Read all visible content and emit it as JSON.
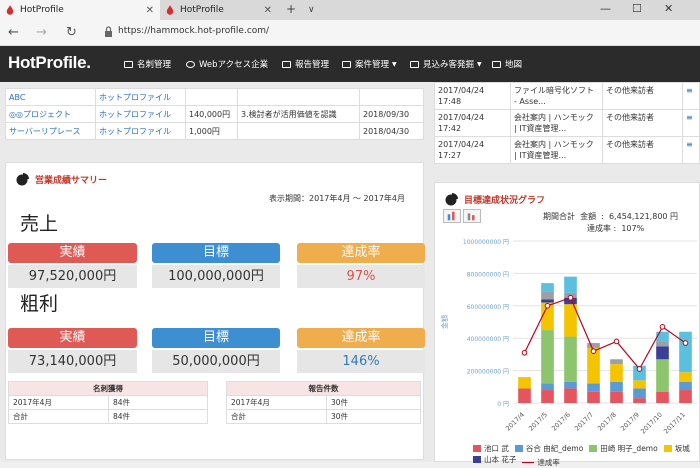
{
  "browser": {
    "tabs": [
      {
        "label": "HotProfile",
        "close": "✕"
      },
      {
        "label": "HotProfile",
        "close": "✕"
      }
    ],
    "url": "https://hammock.hot-profile.com/",
    "new_tab": "+",
    "tab_menu": "∨",
    "win_min": "—",
    "win_max": "☐",
    "win_close": "✕",
    "back": "←",
    "forward": "→",
    "refresh": "↻"
  },
  "nav": {
    "logo": "HotProfile.",
    "items": [
      {
        "label": "名刺管理"
      },
      {
        "label": "Webアクセス企業"
      },
      {
        "label": "報告管理"
      },
      {
        "label": "案件管理",
        "caret": "▼"
      },
      {
        "label": "見込み客発掘",
        "caret": "▼"
      },
      {
        "label": "地図"
      }
    ]
  },
  "top_table": [
    [
      "ABC",
      "ホットプロファイル",
      "",
      "",
      ""
    ],
    [
      "◎◎プロジェクト",
      "ホットプロファイル",
      "140,000円",
      "3.検討者が活用価値を認識",
      "2018/09/30"
    ],
    [
      "サーバーリプレース",
      "ホットプロファイル",
      "1,000円",
      "",
      "2018/04/30"
    ]
  ],
  "right_table": [
    [
      "2017/04/24 17:48",
      "ファイル暗号化ソフト - Asse...",
      "その他来訪者",
      "≡"
    ],
    [
      "2017/04/24 17:42",
      "会社案内 | ハンモック | IT資産管理...",
      "その他来訪者",
      "≡"
    ],
    [
      "2017/04/24 17:27",
      "会社案内 | ハンモック | IT資産管理...",
      "その他来訪者",
      "≡"
    ]
  ],
  "summary": {
    "title": "営業成績サマリー",
    "period": "表示期間：2017年4月 ～ 2017年4月",
    "sales": {
      "heading": "売上",
      "labels": [
        "実績",
        "目標",
        "達成率"
      ],
      "values": [
        "97,520,000円",
        "100,000,000円",
        "97%"
      ]
    },
    "profit": {
      "heading": "粗利",
      "labels": [
        "実績",
        "目標",
        "達成率"
      ],
      "values": [
        "73,140,000円",
        "50,000,000円",
        "146%"
      ]
    },
    "cards": {
      "header": "名刺獲得",
      "rows": [
        [
          "2017年4月",
          "84件"
        ],
        [
          "合計",
          "84件"
        ]
      ]
    },
    "reports": {
      "header": "報告件数",
      "rows": [
        [
          "2017年4月",
          "30件"
        ],
        [
          "合計",
          "30件"
        ]
      ]
    },
    "colors": {
      "red": "#e05a55",
      "blue": "#3d8fd1",
      "orange": "#f0ad4e",
      "pct_red": "#d9534f",
      "pct_blue": "#337ab7"
    }
  },
  "goal_chart": {
    "title": "目標達成状況グラフ",
    "summary_line1_label": "期間合計",
    "summary_line1_key": "金額",
    "summary_line1_value": "6,454,121,800 円",
    "summary_line2_key": "達成率",
    "summary_line2_value": "107%"
  },
  "chart_data": {
    "type": "bar",
    "stacked": true,
    "ylabel": "金額",
    "ylim": [
      0,
      1000000000
    ],
    "yticks": [
      "0 円",
      "200000000 円",
      "400000000 円",
      "600000000 円",
      "800000000 円",
      "1000000000 円"
    ],
    "categories": [
      "2017/4",
      "2017/5",
      "2017/6",
      "2017/7",
      "2017/8",
      "2017/9",
      "2017/10",
      "2017/11"
    ],
    "series": [
      {
        "name": "池口 武",
        "color": "#e5555f",
        "values": [
          90000000,
          80000000,
          90000000,
          70000000,
          70000000,
          30000000,
          70000000,
          80000000
        ]
      },
      {
        "name": "谷合 由紀_demo",
        "color": "#5b9bd5",
        "values": [
          0,
          40000000,
          40000000,
          50000000,
          60000000,
          60000000,
          0,
          50000000
        ]
      },
      {
        "name": "田崎 明子_demo",
        "color": "#8cc56e",
        "values": [
          0,
          330000000,
          280000000,
          0,
          0,
          0,
          200000000,
          0
        ]
      },
      {
        "name": "坂城",
        "color": "#f5c400",
        "values": [
          70000000,
          170000000,
          200000000,
          220000000,
          110000000,
          50000000,
          0,
          60000000
        ]
      },
      {
        "name": "山本 花子",
        "color": "#3a3f98",
        "values": [
          0,
          20000000,
          40000000,
          0,
          0,
          0,
          80000000,
          0
        ]
      },
      {
        "name": "",
        "color": "#9aa0a6",
        "values": [
          0,
          50000000,
          30000000,
          30000000,
          30000000,
          0,
          30000000,
          0
        ]
      },
      {
        "name": "",
        "color": "#5bc0de",
        "values": [
          0,
          50000000,
          100000000,
          0,
          0,
          90000000,
          60000000,
          250000000
        ]
      }
    ],
    "line": {
      "name": "達成率",
      "color": "#c0001a",
      "values": [
        310000000,
        600000000,
        650000000,
        320000000,
        380000000,
        210000000,
        470000000,
        370000000
      ]
    }
  }
}
